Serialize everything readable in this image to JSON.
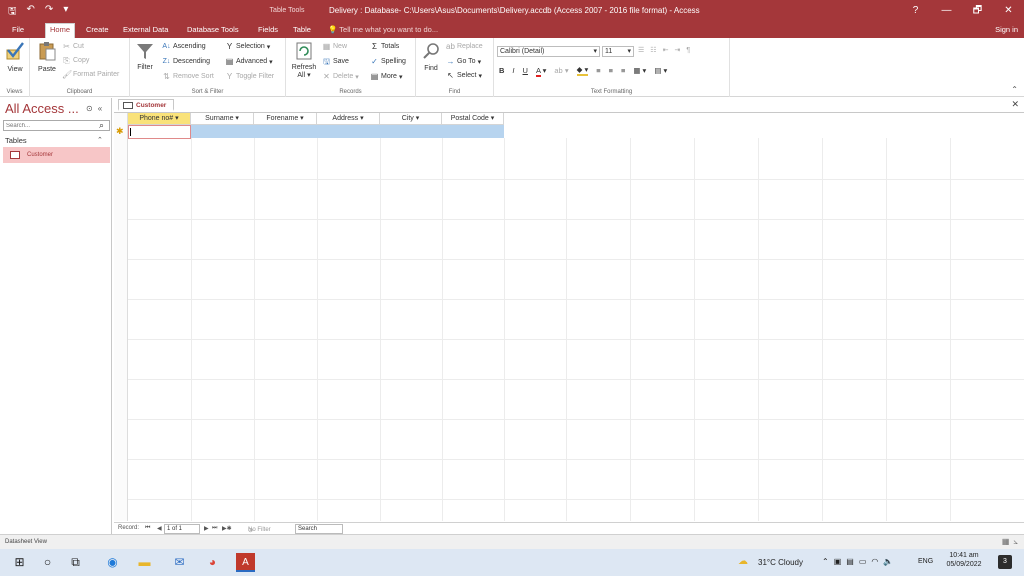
{
  "titlebar": {
    "table_tools": "Table Tools",
    "title": "Delivery : Database- C:\\Users\\Asus\\Documents\\Delivery.accdb (Access 2007 - 2016 file format) - Access",
    "help": "?",
    "minimize": "—",
    "restore": "🗗",
    "close": "✕"
  },
  "tabs": [
    {
      "label": "File"
    },
    {
      "label": "Home"
    },
    {
      "label": "Create"
    },
    {
      "label": "External Data"
    },
    {
      "label": "Database Tools"
    },
    {
      "label": "Fields"
    },
    {
      "label": "Table"
    }
  ],
  "tell_me": "Tell me what you want to do...",
  "sign_in": "Sign in",
  "ribbon": {
    "views": {
      "view": "View",
      "group": "Views"
    },
    "clipboard": {
      "paste": "Paste",
      "cut": "Cut",
      "copy": "Copy",
      "format_painter": "Format Painter",
      "group": "Clipboard"
    },
    "sort_filter": {
      "filter": "Filter",
      "ascending": "Ascending",
      "descending": "Descending",
      "remove_sort": "Remove Sort",
      "selection": "Selection",
      "advanced": "Advanced",
      "toggle_filter": "Toggle Filter",
      "group": "Sort & Filter"
    },
    "records": {
      "refresh": "Refresh",
      "refresh_all": "All",
      "new": "New",
      "save": "Save",
      "delete": "Delete",
      "totals": "Totals",
      "spelling": "Spelling",
      "more": "More",
      "group": "Records"
    },
    "find": {
      "find": "Find",
      "replace": "Replace",
      "go_to": "Go To",
      "select": "Select",
      "group": "Find"
    },
    "text_formatting": {
      "font": "Calibri (Detail)",
      "size": "11",
      "bold": "B",
      "italic": "I",
      "underline": "U",
      "font_color": "A",
      "group": "Text Formatting"
    }
  },
  "nav": {
    "header": "All Access ...",
    "search_placeholder": "Search...",
    "section": "Tables",
    "items": [
      {
        "label": "Customer"
      }
    ]
  },
  "doc": {
    "tab_label": "Customer",
    "columns": [
      {
        "label": "Phone no#"
      },
      {
        "label": "Surname"
      },
      {
        "label": "Forename"
      },
      {
        "label": "Address"
      },
      {
        "label": "City"
      },
      {
        "label": "Postal Code"
      }
    ]
  },
  "record_nav": {
    "label": "Record:",
    "position": "1 of 1",
    "filter": "No Filter",
    "search": "Search"
  },
  "status": {
    "left": "Datasheet View"
  },
  "taskbar": {
    "weather": "31°C  Cloudy",
    "lang": "ENG",
    "time": "10:41 am",
    "date": "05/09/2022",
    "notifications": "3"
  }
}
